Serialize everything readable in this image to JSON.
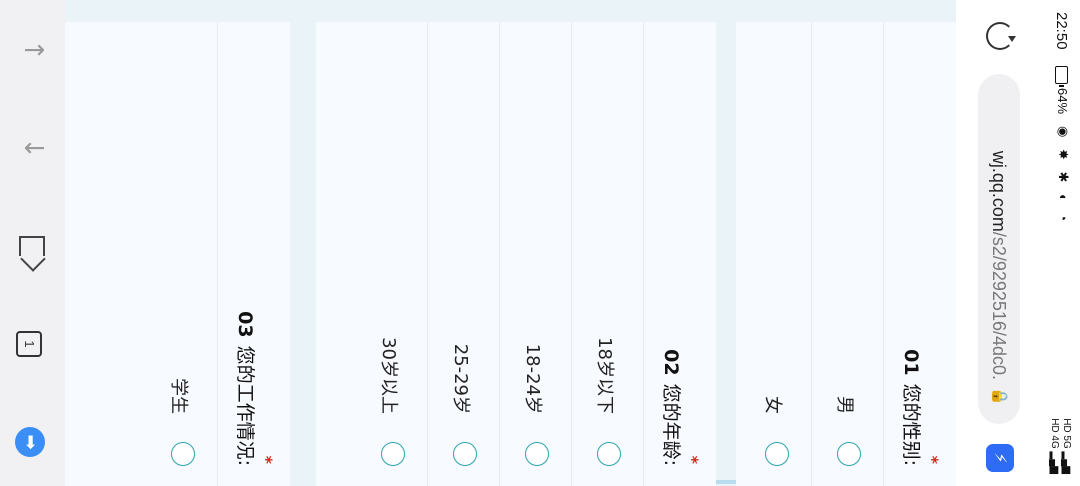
{
  "status_bar": {
    "time": "22:50",
    "battery_percent": "64%",
    "status_icons": "◉ ✸ ✱ ◐ ◔",
    "net_icons_line1": "HD 5G ▂▄▆",
    "net_icons_line2": "HD 4G ▂▄▆"
  },
  "address_bar": {
    "url_host": "wj.qq.com",
    "url_path": "/s2/9292516/4dc0.",
    "tab_icon": "bolt-icon"
  },
  "questions": [
    {
      "number": "01",
      "label": "您的性别:",
      "required_mark": "*",
      "options": [
        "男",
        "女"
      ]
    },
    {
      "number": "02",
      "label": "您的年龄:",
      "required_mark": "*",
      "options": [
        "18岁以下",
        "18-24岁",
        "25-29岁",
        "30岁以上"
      ]
    },
    {
      "number": "03",
      "label": "您的工作情况:",
      "required_mark": "*",
      "options": [
        "学生"
      ]
    }
  ],
  "toolbar": {
    "back_icon": "↑",
    "forward_icon": "↓",
    "tabs_count": "1",
    "menu_icon": "➡"
  }
}
